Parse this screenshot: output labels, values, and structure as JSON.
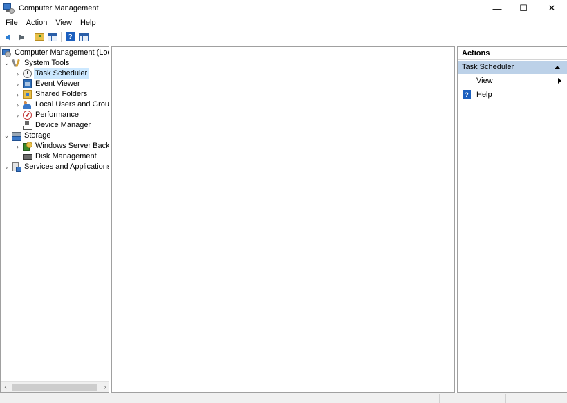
{
  "window": {
    "title": "Computer Management",
    "controls": {
      "minimize": "—",
      "maximize": "☐",
      "close": "✕"
    }
  },
  "menu": [
    "File",
    "Action",
    "View",
    "Help"
  ],
  "toolbar": {
    "buttons": [
      "back-icon",
      "forward-icon",
      "up-folder-icon",
      "show-hide-console-tree-icon",
      "help-icon",
      "show-hide-action-pane-icon"
    ],
    "help_glyph": "?"
  },
  "tree": {
    "root": "Computer Management (Local",
    "items": [
      {
        "label": "System Tools",
        "expanded": true,
        "icon": "tools-icon"
      },
      {
        "label": "Task Scheduler",
        "selected": true,
        "icon": "clock-icon"
      },
      {
        "label": "Event Viewer",
        "icon": "event-viewer-icon"
      },
      {
        "label": "Shared Folders",
        "icon": "shared-folders-icon"
      },
      {
        "label": "Local Users and Groups",
        "icon": "users-icon"
      },
      {
        "label": "Performance",
        "icon": "performance-icon"
      },
      {
        "label": "Device Manager",
        "icon": "device-manager-icon"
      },
      {
        "label": "Storage",
        "expanded": true,
        "icon": "storage-icon"
      },
      {
        "label": "Windows Server Backup",
        "icon": "backup-icon"
      },
      {
        "label": "Disk Management",
        "icon": "disk-icon"
      },
      {
        "label": "Services and Applications",
        "icon": "services-icon"
      }
    ],
    "chevrons": {
      "expanded": "⌄",
      "collapsed": "›"
    }
  },
  "scrollbar": {
    "left": "‹",
    "right": "›"
  },
  "actions": {
    "header": "Actions",
    "section": "Task Scheduler",
    "items": [
      {
        "label": "View",
        "has_submenu": true
      },
      {
        "label": "Help",
        "icon": "help-icon",
        "glyph": "?"
      }
    ]
  },
  "colors": {
    "selection": "#cce8ff",
    "actions_section_bg": "#bcd1e8",
    "border": "#a0a0a0"
  }
}
